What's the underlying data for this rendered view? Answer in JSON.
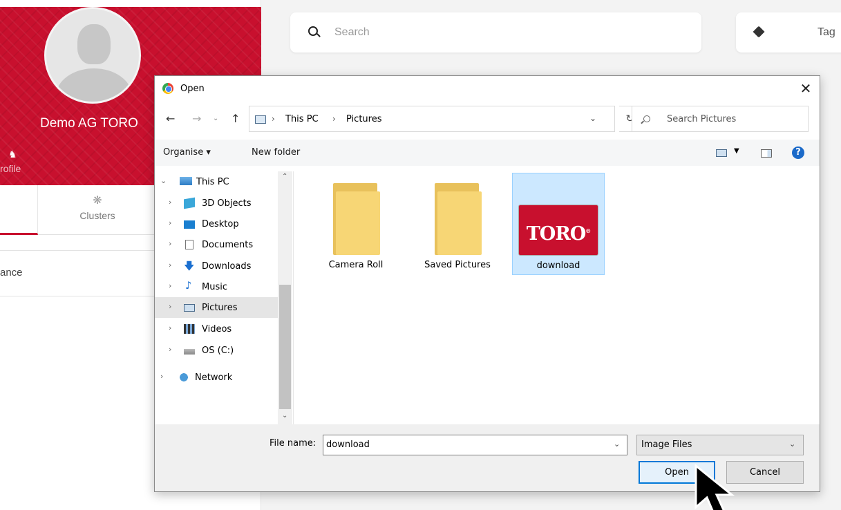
{
  "app": {
    "profile_name": "Demo AG TORO",
    "profile_tab_label": "rofile",
    "clusters_tab_label": "Clusters",
    "section_label": "ance",
    "search_placeholder": "Search",
    "tag_label": "Tag",
    "brand_color": "#c8102e"
  },
  "dialog": {
    "title": "Open",
    "breadcrumb": [
      "This PC",
      "Pictures"
    ],
    "search_placeholder": "Search Pictures",
    "toolbar": {
      "organise": "Organise ▾",
      "new_folder": "New folder"
    },
    "tree": [
      {
        "label": "This PC",
        "icon": "pc-icon",
        "expanded": true
      },
      {
        "label": "3D Objects",
        "icon": "3d-objects-icon"
      },
      {
        "label": "Desktop",
        "icon": "desktop-icon"
      },
      {
        "label": "Documents",
        "icon": "documents-icon"
      },
      {
        "label": "Downloads",
        "icon": "downloads-icon"
      },
      {
        "label": "Music",
        "icon": "music-icon"
      },
      {
        "label": "Pictures",
        "icon": "pictures-icon",
        "selected": true
      },
      {
        "label": "Videos",
        "icon": "videos-icon"
      },
      {
        "label": "OS (C:)",
        "icon": "drive-icon"
      },
      {
        "label": "Network",
        "icon": "network-icon"
      }
    ],
    "files": [
      {
        "name": "Camera Roll",
        "type": "folder"
      },
      {
        "name": "Saved Pictures",
        "type": "folder"
      },
      {
        "name": "download",
        "type": "image",
        "selected": true,
        "thumb_text": "TORO"
      }
    ],
    "file_name_label": "File name:",
    "file_name_value": "download",
    "file_type": "Image Files",
    "open_button": "Open",
    "cancel_button": "Cancel",
    "accent_color": "#0078d7"
  }
}
